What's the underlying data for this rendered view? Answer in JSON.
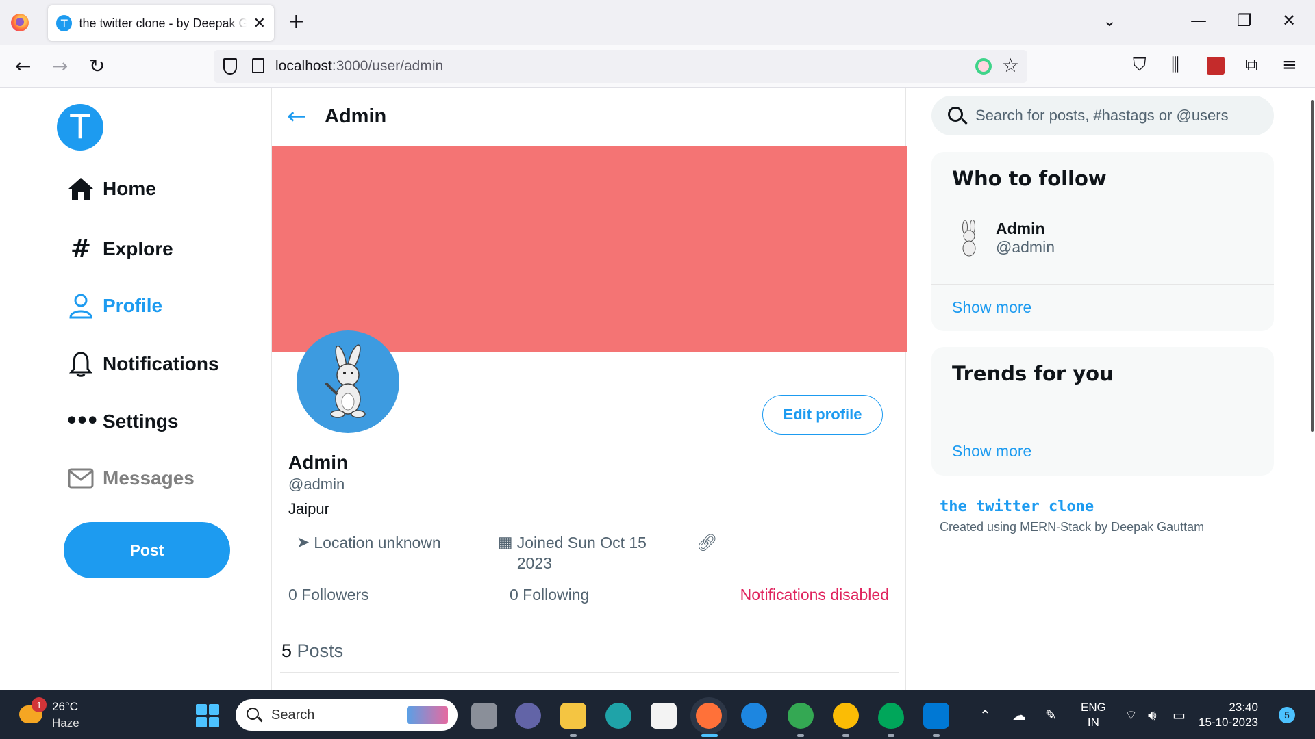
{
  "browser": {
    "tab_title": "the twitter clone - by Deepak Gauttam",
    "tab_favicon_letter": "T",
    "url_host": "localhost",
    "url_path": ":3000/user/admin"
  },
  "sidebar": {
    "logo_letter": "T",
    "items": [
      {
        "label": "Home",
        "icon": "home-icon"
      },
      {
        "label": "Explore",
        "icon": "hashtag-icon"
      },
      {
        "label": "Profile",
        "icon": "user-icon"
      },
      {
        "label": "Notifications",
        "icon": "bell-icon"
      },
      {
        "label": "Settings",
        "icon": "more-icon"
      },
      {
        "label": "Messages",
        "icon": "mail-icon"
      }
    ],
    "post_label": "Post"
  },
  "profile": {
    "header_title": "Admin",
    "name": "Admin",
    "handle": "@admin",
    "bio": "Jaipur",
    "location": "Location unknown",
    "joined_line1": "Joined Sun Oct 15",
    "joined_line2": "2023",
    "followers": "0 Followers",
    "following": "0 Following",
    "notifications": "Notifications disabled",
    "edit_label": "Edit profile",
    "posts_count": "5",
    "posts_label": "Posts",
    "cover_color": "#f47474"
  },
  "right": {
    "search_placeholder": "Search for posts, #hastags or @users",
    "who_to_follow": {
      "title": "Who to follow",
      "user_name": "Admin",
      "user_handle": "@admin",
      "show_more": "Show more"
    },
    "trends": {
      "title": "Trends for you",
      "show_more": "Show more"
    },
    "footer_title": "the twitter clone",
    "footer_sub": "Created using MERN-Stack by Deepak Gauttam"
  },
  "taskbar": {
    "weather_temp": "26°C",
    "weather_desc": "Haze",
    "weather_badge": "1",
    "search_label": "Search",
    "lang1": "ENG",
    "lang2": "IN",
    "time": "23:40",
    "date": "15-10-2023",
    "notif_count": "5"
  },
  "colors": {
    "accent": "#1d9bf0",
    "danger": "#e0245e"
  }
}
